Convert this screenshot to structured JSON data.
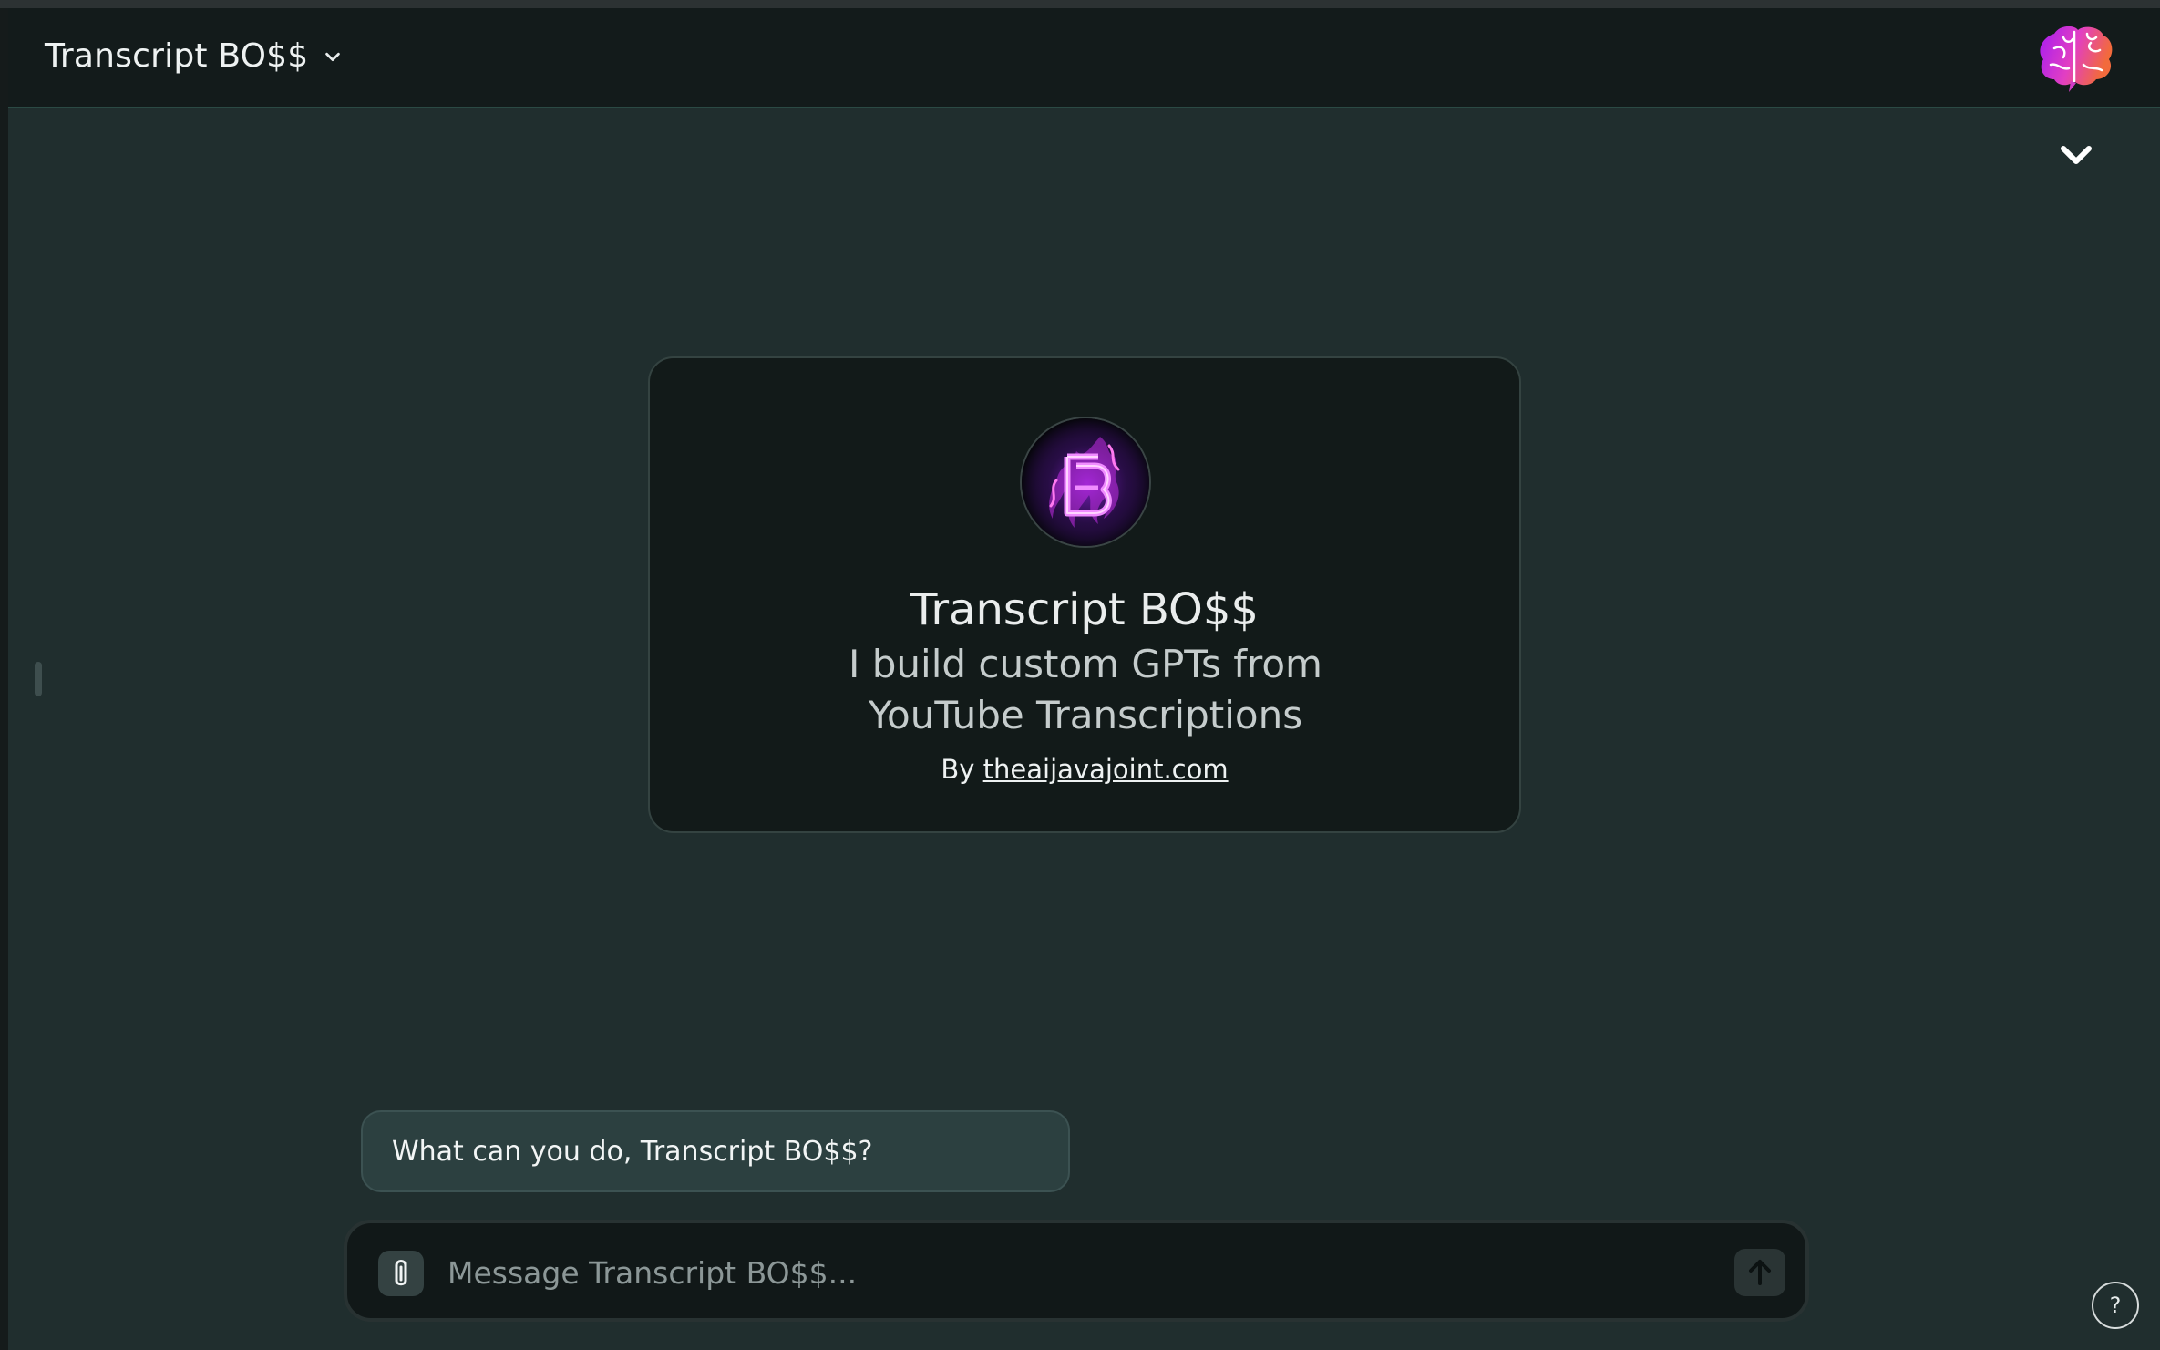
{
  "header": {
    "model_title": "Transcript BO$$",
    "model_chevron_icon": "chevron-down-icon",
    "brand_icon": "brain-icon"
  },
  "scroll": {
    "icon": "chevron-down-icon"
  },
  "gpt_card": {
    "name": "Transcript BO$$",
    "description": "I build custom GPTs from YouTube Transcriptions",
    "by_prefix": "By",
    "author_link": "theaijavajoint.com",
    "avatar_icon": "flaming-b-logo"
  },
  "suggestions": [
    {
      "label": "What can you do, Transcript BO$$?"
    }
  ],
  "composer": {
    "placeholder": "Message Transcript BO$$...",
    "attach_icon": "paperclip-icon",
    "send_icon": "arrow-up-icon"
  },
  "help": {
    "label": "?"
  },
  "colors": {
    "background": "#202e2e",
    "header": "#131b1b",
    "card": "#121a19",
    "suggestion": "#2c4040",
    "accent": "#c63cff"
  }
}
